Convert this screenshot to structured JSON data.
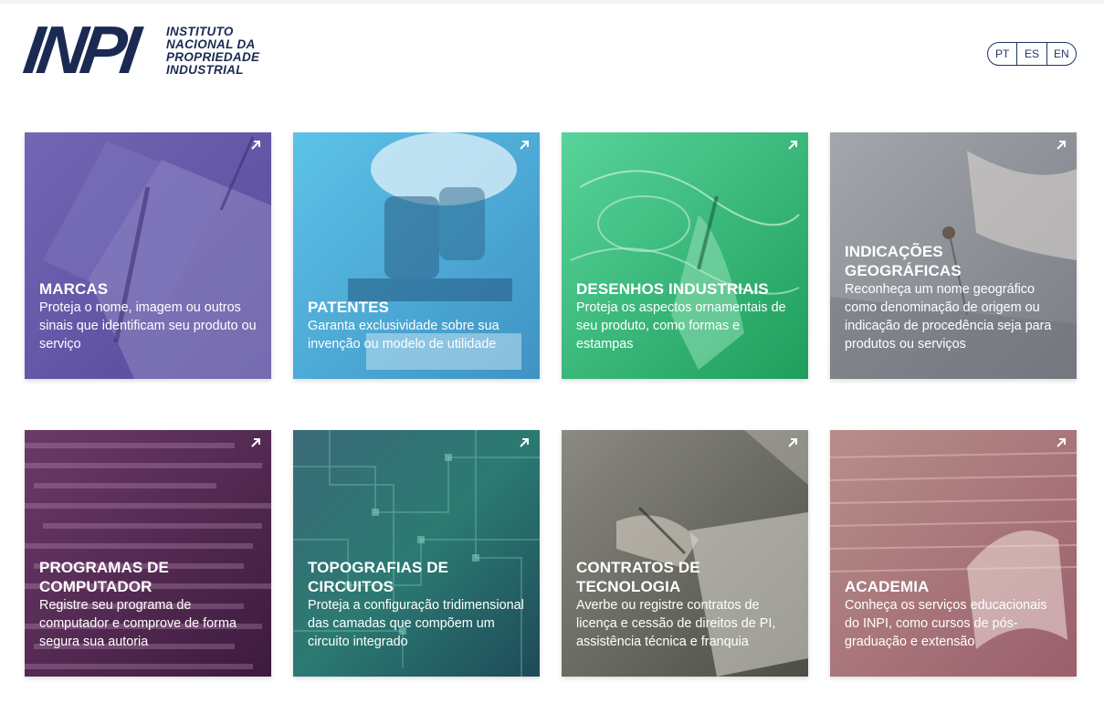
{
  "header": {
    "logo_mark": "INPI",
    "logo_lines": [
      "INSTITUTO",
      "NACIONAL DA",
      "PROPRIEDADE",
      "INDUSTRIAL"
    ],
    "languages": [
      "PT",
      "ES",
      "EN"
    ]
  },
  "cards": [
    {
      "title": "MARCAS",
      "description": "Proteja o nome, imagem ou outros sinais que identificam seu produto ou serviço",
      "icon": "external-arrow-icon",
      "color": "#7a6bbf"
    },
    {
      "title": "PATENTES",
      "description": "Garanta exclusividade sobre sua invenção ou modelo de utilidade",
      "icon": "external-arrow-icon",
      "color": "#4eaed8"
    },
    {
      "title": "DESENHOS INDUSTRIAIS",
      "description": "Proteja os aspectos ornamentais de seu produto, como formas e estampas",
      "icon": "external-arrow-icon",
      "color": "#2fb872"
    },
    {
      "title": "INDICAÇÕES GEOGRÁFICAS",
      "description": "Reconheça um nome geográfico como denominação de origem ou indicação de procedência seja para produtos ou serviços",
      "icon": "external-arrow-icon",
      "color": "#8c8f96"
    },
    {
      "title": "PROGRAMAS DE COMPUTADOR",
      "description": "Registre seu programa de computador e comprove de forma segura sua autoria",
      "icon": "external-arrow-icon",
      "color": "#5a2a55"
    },
    {
      "title": "TOPOGRAFIAS DE CIRCUITOS",
      "description": "Proteja a configuração tridimensional das camadas que compõem um circuito integrado",
      "icon": "external-arrow-icon",
      "color": "#2a5a6a"
    },
    {
      "title": "CONTRATOS DE TECNOLOGIA",
      "description": "Averbe ou registre contratos de licença e cessão de direitos de PI, assistência técnica e franquia",
      "icon": "external-arrow-icon",
      "color": "#6b6b62"
    },
    {
      "title": "ACADEMIA",
      "description": "Conheça os serviços educacionais do INPI, como cursos de pós-graduação e extensão",
      "icon": "external-arrow-icon",
      "color": "#a66a74"
    }
  ]
}
